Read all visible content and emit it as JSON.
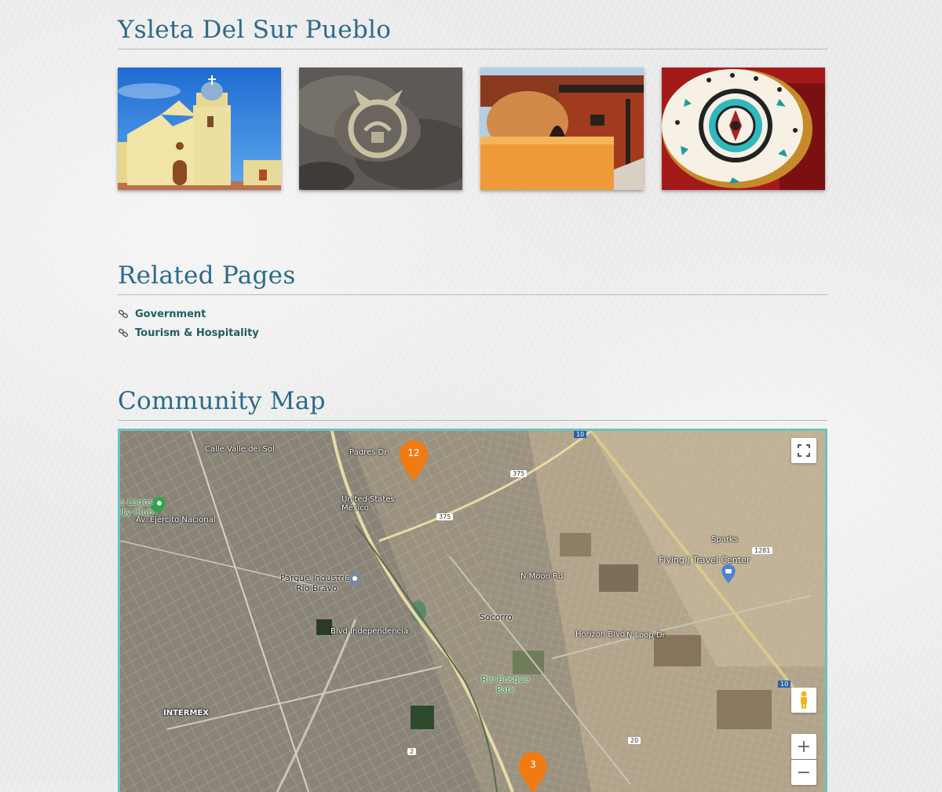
{
  "sections": {
    "community": {
      "title": "Ysleta Del Sur Pueblo"
    },
    "related": {
      "title": "Related Pages"
    },
    "map": {
      "title": "Community Map"
    }
  },
  "gallery": [
    {
      "alt": "mission-church"
    },
    {
      "alt": "petroglyph"
    },
    {
      "alt": "adobe-horno-oven"
    },
    {
      "alt": "painted-drum"
    }
  ],
  "related_links": [
    {
      "label": "Government",
      "icon": "link-icon"
    },
    {
      "label": "Tourism & Hospitality",
      "icon": "link-icon"
    }
  ],
  "map": {
    "labels": {
      "calle_valle_del_sol": "Calle Valle del Sol",
      "padres_dr": "Padres Dr",
      "lagos_club": "s Lagos\nity Club",
      "parque": "Parque Industrial\nRío Bravo",
      "socorro": "Socorro",
      "rio_bosque": "Rio Bosque\nPark",
      "intermex": "INTERMEX",
      "sparks": "Sparks",
      "flying_j": "Flying J Travel Center",
      "horizon_blvd": "Horizon Blvd",
      "n_loop_dr": "N Loop Dr",
      "n_moon_rd": "N Moon Rd",
      "av_ejercito": "Av. Ejército Nacional",
      "blvd_independencia": "Blvd Independencia",
      "united_states_mexico": "United States\nMéxico"
    },
    "shields": {
      "i10_top": "10",
      "i10_right": "10",
      "r375_a": "375",
      "r375_b": "375",
      "r1281": "1281",
      "r20": "20",
      "r2": "2"
    },
    "clusters": [
      {
        "count": "12",
        "color": "#f07b13"
      },
      {
        "count": "3",
        "color": "#f07b13"
      }
    ],
    "controls": {
      "zoom_in": "+",
      "zoom_out": "−"
    }
  }
}
